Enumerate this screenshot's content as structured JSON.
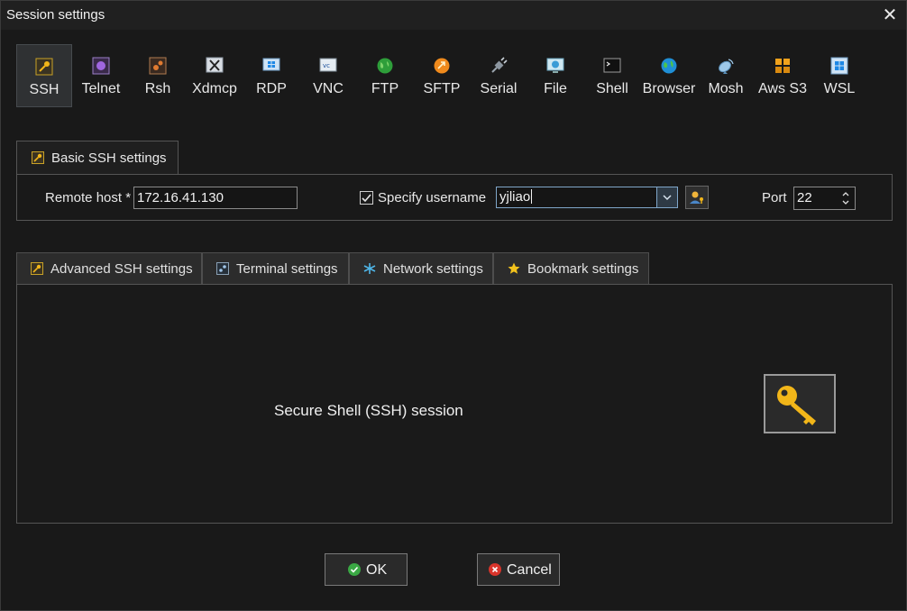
{
  "window": {
    "title": "Session settings"
  },
  "session_types": [
    {
      "label": "SSH",
      "icon": "ssh-key-icon",
      "active": true
    },
    {
      "label": "Telnet",
      "icon": "telnet-icon"
    },
    {
      "label": "Rsh",
      "icon": "rsh-icon"
    },
    {
      "label": "Xdmcp",
      "icon": "xdmcp-icon"
    },
    {
      "label": "RDP",
      "icon": "rdp-icon"
    },
    {
      "label": "VNC",
      "icon": "vnc-icon"
    },
    {
      "label": "FTP",
      "icon": "ftp-globe-icon"
    },
    {
      "label": "SFTP",
      "icon": "sftp-icon"
    },
    {
      "label": "Serial",
      "icon": "serial-plug-icon"
    },
    {
      "label": "File",
      "icon": "file-icon"
    },
    {
      "label": "Shell",
      "icon": "shell-terminal-icon"
    },
    {
      "label": "Browser",
      "icon": "browser-globe-icon"
    },
    {
      "label": "Mosh",
      "icon": "mosh-dish-icon"
    },
    {
      "label": "Aws S3",
      "icon": "aws-s3-icon"
    },
    {
      "label": "WSL",
      "icon": "wsl-windows-icon"
    }
  ],
  "basic": {
    "tab_label": "Basic SSH settings",
    "remote_host_label": "Remote host *",
    "remote_host_value": "172.16.41.130",
    "specify_username_label": "Specify username",
    "specify_username_checked": true,
    "username_value": "yjliao",
    "port_label": "Port",
    "port_value": "22"
  },
  "tabs": [
    {
      "label": "Advanced SSH settings",
      "icon": "ssh-key-icon"
    },
    {
      "label": "Terminal settings",
      "icon": "terminal-icon"
    },
    {
      "label": "Network settings",
      "icon": "network-star-icon"
    },
    {
      "label": "Bookmark settings",
      "icon": "bookmark-star-icon"
    }
  ],
  "panel": {
    "description": "Secure Shell (SSH) session",
    "icon": "large-key-icon"
  },
  "buttons": {
    "ok_label": "OK",
    "cancel_label": "Cancel"
  },
  "colors": {
    "background": "#191919",
    "active_tool": "#2f3133",
    "combo_focus": "#7fa6c9",
    "ok_green": "#3aa844",
    "cancel_red": "#d9342b",
    "key_gold": "#f2b619"
  }
}
